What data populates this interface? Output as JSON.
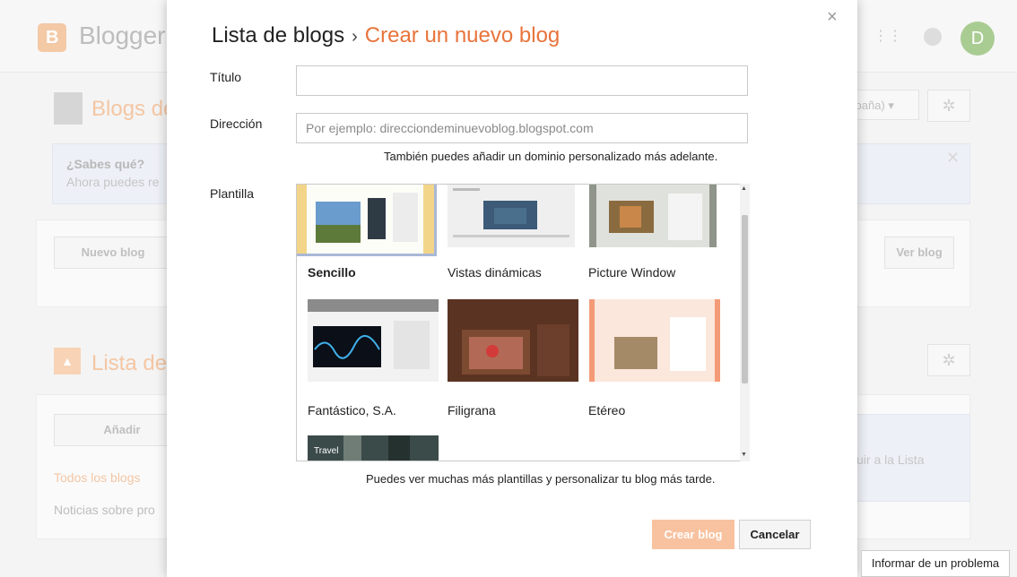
{
  "background": {
    "logo_letter": "B",
    "logo_text": "Blogger",
    "avatar_letter": "D",
    "blogs_title": "Blogs de",
    "language_partial": "spaña)",
    "tip_title": "¿Sabes qué?",
    "tip_text": "Ahora puedes re",
    "new_blog_button": "Nuevo blog",
    "view_blog_button": "Ver blog",
    "reading_list_title": "Lista de",
    "add_button": "Añadir",
    "all_blogs_link": "Todos los blogs",
    "news_link": "Noticias sobre pro",
    "add_to_list_partial": "uir a la Lista"
  },
  "dialog": {
    "breadcrumb_parent": "Lista de blogs",
    "breadcrumb_separator": "›",
    "breadcrumb_current": "Crear un nuevo blog",
    "title_label": "Título",
    "title_value": "",
    "address_label": "Dirección",
    "address_placeholder": "Por ejemplo: direcciondeminuevoblog.blogspot.com",
    "address_hint": "También puedes añadir un dominio personalizado más adelante.",
    "template_label": "Plantilla",
    "templates": [
      {
        "name": "Sencillo",
        "selected": true
      },
      {
        "name": "Vistas dinámicas",
        "selected": false
      },
      {
        "name": "Picture Window",
        "selected": false
      },
      {
        "name": "Fantástico, S.A.",
        "selected": false
      },
      {
        "name": "Filigrana",
        "selected": false
      },
      {
        "name": "Etéreo",
        "selected": false
      },
      {
        "name": "Travel",
        "selected": false
      }
    ],
    "template_hint": "Puedes ver muchas más plantillas y personalizar tu blog más tarde.",
    "create_button": "Crear blog",
    "cancel_button": "Cancelar",
    "close_symbol": "×"
  },
  "report_problem": "Informar de un problema"
}
